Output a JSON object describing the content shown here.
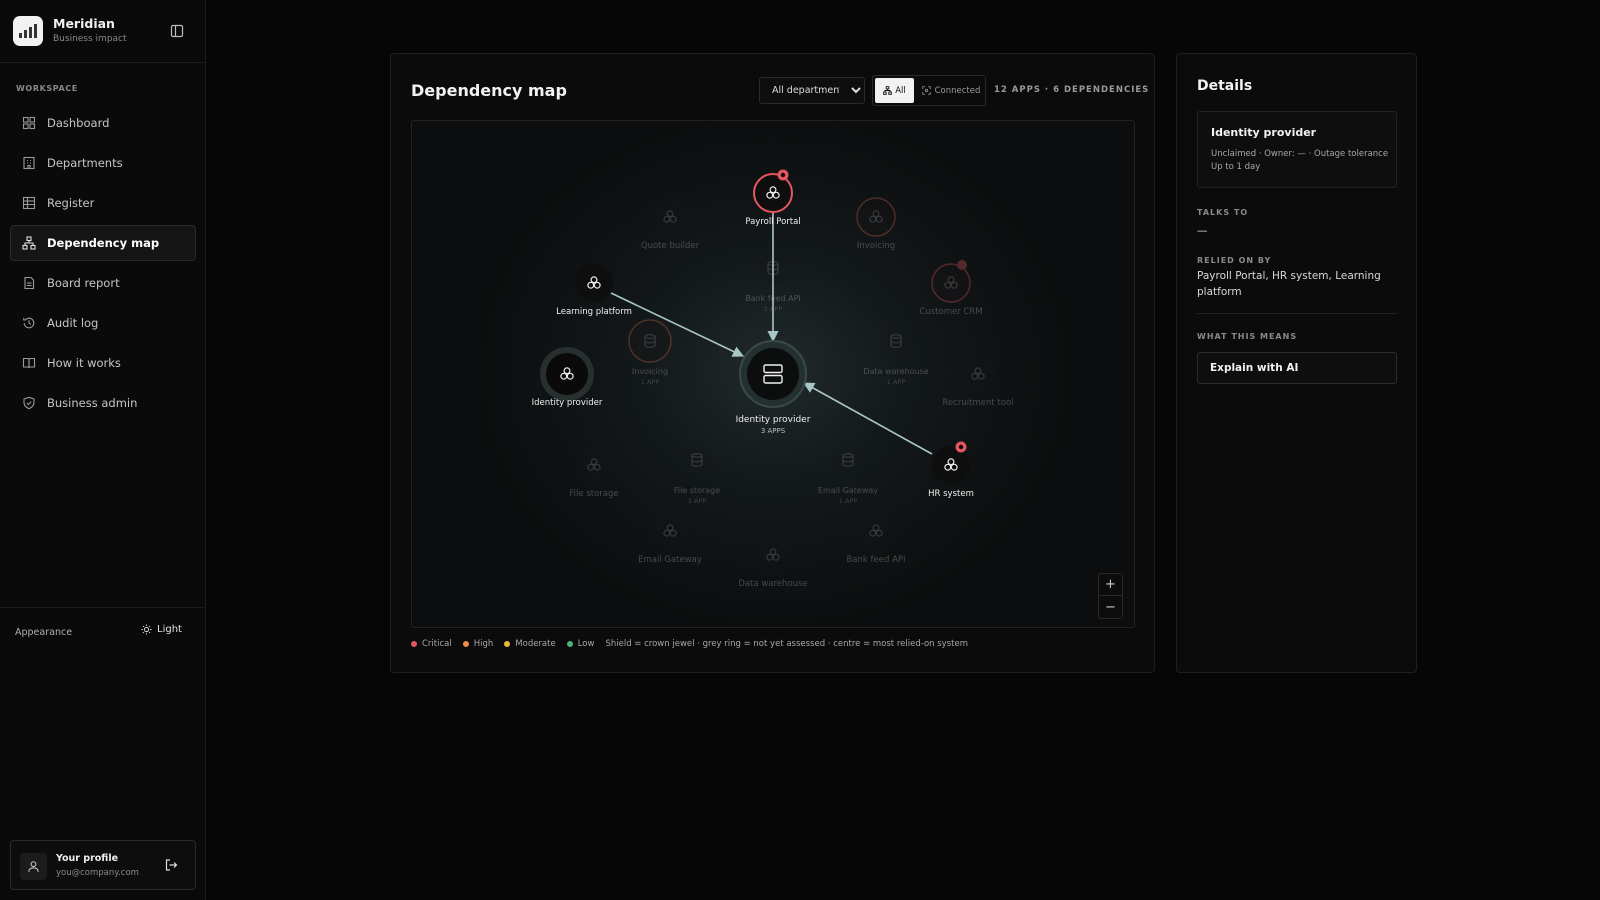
{
  "brand": {
    "name": "Meridian",
    "subtitle": "Business impact"
  },
  "sidebar": {
    "section_label": "WORKSPACE",
    "items": [
      {
        "label": "Dashboard",
        "icon": "grid-icon",
        "active": false
      },
      {
        "label": "Departments",
        "icon": "building-icon",
        "active": false
      },
      {
        "label": "Register",
        "icon": "table-icon",
        "active": false
      },
      {
        "label": "Dependency map",
        "icon": "network-icon",
        "active": true
      },
      {
        "label": "Board report",
        "icon": "document-icon",
        "active": false
      },
      {
        "label": "Audit log",
        "icon": "history-icon",
        "active": false
      },
      {
        "label": "How it works",
        "icon": "book-icon",
        "active": false
      },
      {
        "label": "Business admin",
        "icon": "shield-icon",
        "active": false
      }
    ],
    "appearance_label": "Appearance",
    "theme_toggle_label": "Light",
    "profile": {
      "name": "Your profile",
      "email": "you@company.com"
    }
  },
  "map": {
    "title": "Dependency map",
    "department_filter": {
      "selected": "All departments",
      "options": [
        "All departments"
      ]
    },
    "view_toggle": {
      "all_label": "All",
      "connected_label": "Connected",
      "selected": "All"
    },
    "counts_label": "12 APPS · 6 DEPENDENCIES",
    "center_node": {
      "label": "Identity provider",
      "sub": "3 APPS"
    },
    "active_nodes": [
      {
        "id": "payroll",
        "label": "Payroll Portal",
        "risk": "Critical",
        "crown_jewel": true
      },
      {
        "id": "learning",
        "label": "Learning platform",
        "risk": "",
        "crown_jewel": false
      },
      {
        "id": "idp-app",
        "label": "Identity provider",
        "risk": "",
        "crown_jewel": false
      },
      {
        "id": "hr",
        "label": "HR system",
        "risk": "",
        "crown_jewel": true
      }
    ],
    "faded_nodes": [
      {
        "label": "Quote builder",
        "sub": "",
        "kind": "app"
      },
      {
        "label": "Invoicing",
        "sub": "",
        "kind": "app"
      },
      {
        "label": "Bank feed API",
        "sub": "1 APP",
        "kind": "data"
      },
      {
        "label": "Customer CRM",
        "sub": "",
        "kind": "app"
      },
      {
        "label": "Invoicing",
        "sub": "1 APP",
        "kind": "data"
      },
      {
        "label": "Data warehouse",
        "sub": "1 APP",
        "kind": "data"
      },
      {
        "label": "Recruitment tool",
        "sub": "",
        "kind": "app"
      },
      {
        "label": "File storage",
        "sub": "",
        "kind": "app"
      },
      {
        "label": "File storage",
        "sub": "1 APP",
        "kind": "data"
      },
      {
        "label": "Email Gateway",
        "sub": "1 APP",
        "kind": "data"
      },
      {
        "label": "Email Gateway",
        "sub": "",
        "kind": "app"
      },
      {
        "label": "Data warehouse",
        "sub": "",
        "kind": "app"
      },
      {
        "label": "Bank feed API",
        "sub": "",
        "kind": "app"
      }
    ],
    "zoom": {
      "in_label": "+",
      "out_label": "−"
    },
    "legend": [
      {
        "label": "Critical",
        "color": "#e5575f"
      },
      {
        "label": "High",
        "color": "#ef8a4f"
      },
      {
        "label": "Moderate",
        "color": "#e6b83c"
      },
      {
        "label": "Low",
        "color": "#4bb37a"
      }
    ],
    "legend_note": "Shield = crown jewel · grey ring = not yet assessed · centre = most relied-on system"
  },
  "details": {
    "title": "Details",
    "card": {
      "name": "Identity provider",
      "meta": "Unclaimed · Owner: — · Outage tolerance Up to 1 day"
    },
    "talks_to_label": "TALKS TO",
    "talks_to_value": "—",
    "relied_on_by_label": "RELIED ON BY",
    "relied_on_by_value": "Payroll Portal, HR system, Learning platform",
    "what_means_label": "WHAT THIS MEANS",
    "explain_button": "Explain with AI"
  }
}
